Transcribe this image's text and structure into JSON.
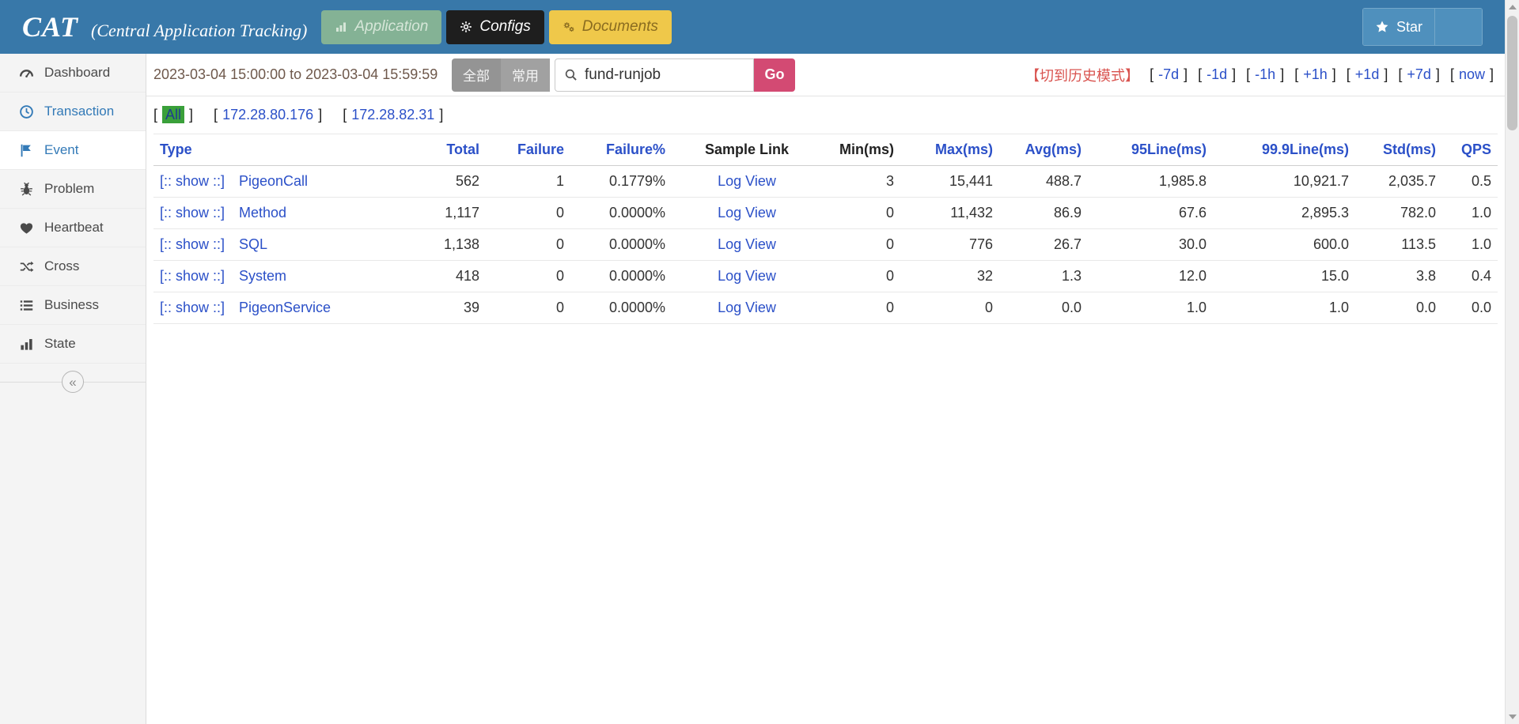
{
  "punct": {
    "open": "[",
    "close": "]"
  },
  "colors": {
    "header_bg": "#3878a9",
    "accent_green": "#3aa03a",
    "link_blue": "#2b50c8",
    "sidebar_link_blue": "#337ab7",
    "go_pink": "#d34a73",
    "history_red": "#d9534f",
    "documents_yellow": "#efc84a"
  },
  "header": {
    "logo": "CAT",
    "subtitle": "(Central Application Tracking)",
    "nav_buttons": [
      {
        "id": "application",
        "label": "Application",
        "icon": "bar-chart-icon"
      },
      {
        "id": "configs",
        "label": "Configs",
        "icon": "gear-icon"
      },
      {
        "id": "documents",
        "label": "Documents",
        "icon": "gears-icon"
      }
    ],
    "star_label": "Star"
  },
  "toolbar": {
    "date_range": "2023-03-04 15:00:00 to 2023-03-04 15:59:59",
    "group_buttons": [
      {
        "label": "全部"
      },
      {
        "label": "常用"
      }
    ],
    "search": {
      "value": "fund-runjob"
    },
    "go_label": "Go",
    "history_mode_label": "【切到历史模式】",
    "time_links": [
      "-7d",
      "-1d",
      "-1h",
      "+1h",
      "+1d",
      "+7d",
      "now"
    ]
  },
  "sidebar": {
    "items": [
      {
        "label": "Dashboard",
        "icon": "gauge-icon",
        "active": false,
        "link": false
      },
      {
        "label": "Transaction",
        "icon": "clock-icon",
        "active": false,
        "link": true
      },
      {
        "label": "Event",
        "icon": "flag-icon",
        "active": true,
        "link": true
      },
      {
        "label": "Problem",
        "icon": "bug-icon",
        "active": false,
        "link": false
      },
      {
        "label": "Heartbeat",
        "icon": "heart-icon",
        "active": false,
        "link": false
      },
      {
        "label": "Cross",
        "icon": "shuffle-icon",
        "active": false,
        "link": false
      },
      {
        "label": "Business",
        "icon": "list-icon",
        "active": false,
        "link": false
      },
      {
        "label": "State",
        "icon": "chart-icon",
        "active": false,
        "link": false
      }
    ],
    "collapse_icon": "«"
  },
  "machines": {
    "all": "All",
    "ips": [
      "172.28.80.176",
      "172.28.82.31"
    ]
  },
  "table": {
    "show_label": "[:: show ::]",
    "sample_label": "Log View",
    "columns": [
      {
        "label": "Type",
        "sortable": true,
        "align": "left"
      },
      {
        "label": "Total",
        "sortable": true,
        "align": "right"
      },
      {
        "label": "Failure",
        "sortable": true,
        "align": "right"
      },
      {
        "label": "Failure%",
        "sortable": true,
        "align": "right"
      },
      {
        "label": "Sample Link",
        "sortable": false,
        "align": "center"
      },
      {
        "label": "Min(ms)",
        "sortable": false,
        "align": "right"
      },
      {
        "label": "Max(ms)",
        "sortable": true,
        "align": "right"
      },
      {
        "label": "Avg(ms)",
        "sortable": true,
        "align": "right"
      },
      {
        "label": "95Line(ms)",
        "sortable": true,
        "align": "right"
      },
      {
        "label": "99.9Line(ms)",
        "sortable": true,
        "align": "right"
      },
      {
        "label": "Std(ms)",
        "sortable": true,
        "align": "right"
      },
      {
        "label": "QPS",
        "sortable": true,
        "align": "right"
      }
    ],
    "rows": [
      {
        "type": "PigeonCall",
        "total": "562",
        "failure": "1",
        "failure_pct": "0.1779%",
        "min": "3",
        "max": "15,441",
        "avg": "488.7",
        "line95": "1,985.8",
        "line999": "10,921.7",
        "std": "2,035.7",
        "qps": "0.5"
      },
      {
        "type": "Method",
        "total": "1,117",
        "failure": "0",
        "failure_pct": "0.0000%",
        "min": "0",
        "max": "11,432",
        "avg": "86.9",
        "line95": "67.6",
        "line999": "2,895.3",
        "std": "782.0",
        "qps": "1.0"
      },
      {
        "type": "SQL",
        "total": "1,138",
        "failure": "0",
        "failure_pct": "0.0000%",
        "min": "0",
        "max": "776",
        "avg": "26.7",
        "line95": "30.0",
        "line999": "600.0",
        "std": "113.5",
        "qps": "1.0"
      },
      {
        "type": "System",
        "total": "418",
        "failure": "0",
        "failure_pct": "0.0000%",
        "min": "0",
        "max": "32",
        "avg": "1.3",
        "line95": "12.0",
        "line999": "15.0",
        "std": "3.8",
        "qps": "0.4"
      },
      {
        "type": "PigeonService",
        "total": "39",
        "failure": "0",
        "failure_pct": "0.0000%",
        "min": "0",
        "max": "0",
        "avg": "0.0",
        "line95": "1.0",
        "line999": "1.0",
        "std": "0.0",
        "qps": "0.0"
      }
    ]
  }
}
